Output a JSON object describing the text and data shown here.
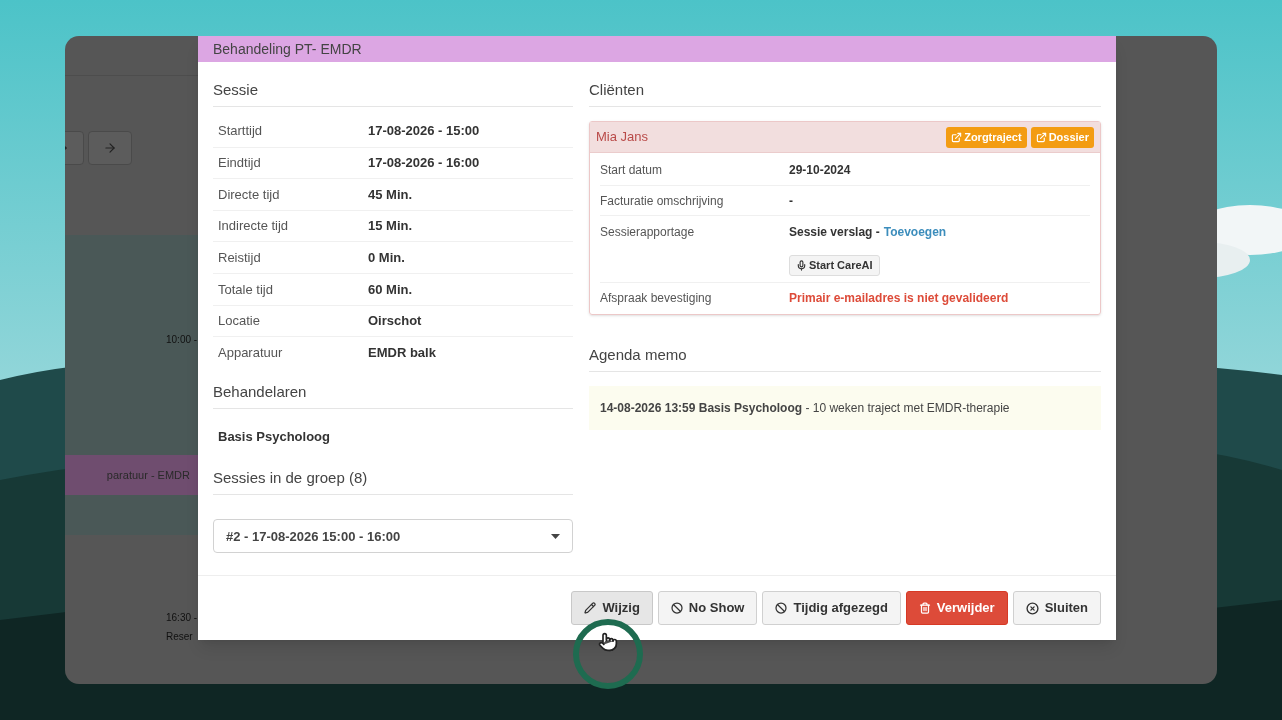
{
  "background_calendar": {
    "time_labels": [
      "10:00 -",
      "16:30 -"
    ],
    "event": "paratuur - EMDR",
    "reservation": "Reser"
  },
  "modal": {
    "title": "Behandeling PT- EMDR",
    "session": {
      "heading": "Sessie",
      "rows": [
        {
          "label": "Starttijd",
          "value": "17-08-2026 - 15:00"
        },
        {
          "label": "Eindtijd",
          "value": "17-08-2026 - 16:00"
        },
        {
          "label": "Directe tijd",
          "value": "45 Min."
        },
        {
          "label": "Indirecte tijd",
          "value": "15 Min."
        },
        {
          "label": "Reistijd",
          "value": "0 Min."
        },
        {
          "label": "Totale tijd",
          "value": "60 Min."
        },
        {
          "label": "Locatie",
          "value": "Oirschot"
        },
        {
          "label": "Apparatuur",
          "value": "EMDR balk"
        }
      ]
    },
    "practitioners": {
      "heading": "Behandelaren",
      "names": [
        "Basis Psycholoog"
      ]
    },
    "group_sessions": {
      "heading": "Sessies in de groep (8)",
      "value": "#2 - 17-08-2026 15:00 - 16:00"
    },
    "clients": {
      "heading": "Cliënten",
      "client": {
        "name": "Mia Jans",
        "buttons": [
          "Zorgtraject",
          "Dossier"
        ],
        "rows": [
          {
            "kind": "text",
            "label": "Start datum",
            "value": "29-10-2024"
          },
          {
            "kind": "text",
            "label": "Facturatie omschrijving",
            "value": "-"
          },
          {
            "kind": "report",
            "label": "Sessierapportage",
            "value": "Sessie verslag -",
            "link": "Toevoegen",
            "button": "Start CareAI"
          },
          {
            "kind": "error",
            "label": "Afspraak bevestiging",
            "value": "Primair e-mailadres is niet gevalideerd"
          }
        ]
      }
    },
    "memo": {
      "heading": "Agenda memo",
      "text": "**14-08-2026 13:59 Basis Psycholoog** - 10 weken traject met EMDR-therapie"
    },
    "footer_buttons": [
      {
        "kind": "edit",
        "label": "Wijzig"
      },
      {
        "kind": "ban",
        "label": "No Show"
      },
      {
        "kind": "ban",
        "label": "Tijdig afgezegd"
      },
      {
        "kind": "delete",
        "label": "Verwijder"
      },
      {
        "kind": "close",
        "label": "Sluiten"
      }
    ]
  }
}
